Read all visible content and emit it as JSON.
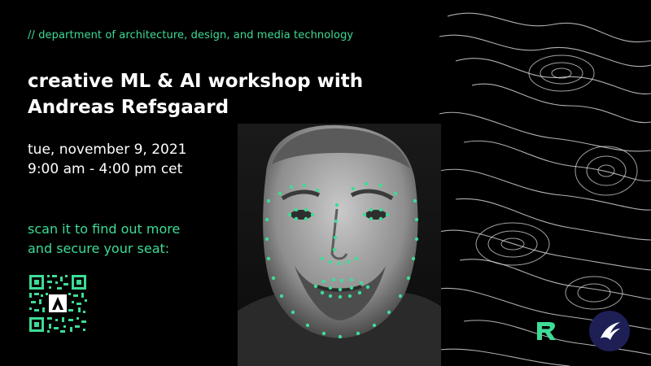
{
  "header": {
    "department": "// department of architecture, design, and media technology"
  },
  "title": {
    "line1": "creative ML & AI workshop with",
    "line2": "Andreas Refsgaard"
  },
  "schedule": {
    "date": "tue, november 9, 2021",
    "time": "9:00 am - 4:00 pm cet"
  },
  "cta": {
    "line1": "scan it to find out more",
    "line2": "and secure your seat:"
  },
  "colors": {
    "accent": "#3ddc97",
    "background": "#000000",
    "text": "#ffffff",
    "badge": "#1d1f55"
  },
  "icons": {
    "qr": "qr-code-icon",
    "brand_r": "r-logo-icon",
    "brand_badge": "bird-logo-icon"
  }
}
